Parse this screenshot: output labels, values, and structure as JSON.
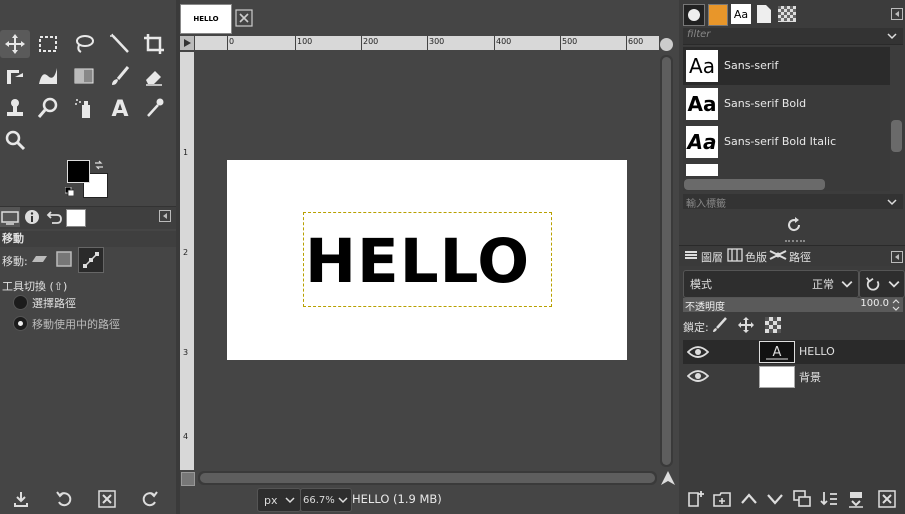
{
  "image_tab": {
    "thumb_text": "HELLO"
  },
  "tool_options": {
    "title": "移動",
    "move_label": "移動:",
    "toggle_label": "工具切換 (⇧)",
    "options": [
      "選擇路徑",
      "移動使用中的路徑"
    ]
  },
  "ruler": {
    "h_ticks": [
      "0",
      "100",
      "200",
      "300",
      "400",
      "500",
      "600"
    ],
    "v_ticks": [
      "1",
      "2",
      "3",
      "4"
    ]
  },
  "canvas": {
    "text": "HELLO"
  },
  "status": {
    "unit": "px",
    "zoom": "66.7%",
    "title": "HELLO (1.9 MB)"
  },
  "fonts": {
    "filter_placeholder": "filter",
    "items": [
      {
        "preview": "Aa",
        "name": "Sans-serif"
      },
      {
        "preview": "Aa",
        "name": "Sans-serif Bold"
      },
      {
        "preview": "Aa",
        "name": "Sans-serif Bold Italic"
      }
    ],
    "tag_placeholder": "輸入標籤"
  },
  "layers_dock": {
    "tabs": [
      "圖層",
      "色版",
      "路徑"
    ],
    "mode_label": "模式",
    "mode_value": "正常",
    "opacity_label": "不透明度",
    "opacity_value": "100.0",
    "lock_label": "鎖定:",
    "layers": [
      {
        "name": "HELLO"
      },
      {
        "name": "背景"
      }
    ]
  }
}
